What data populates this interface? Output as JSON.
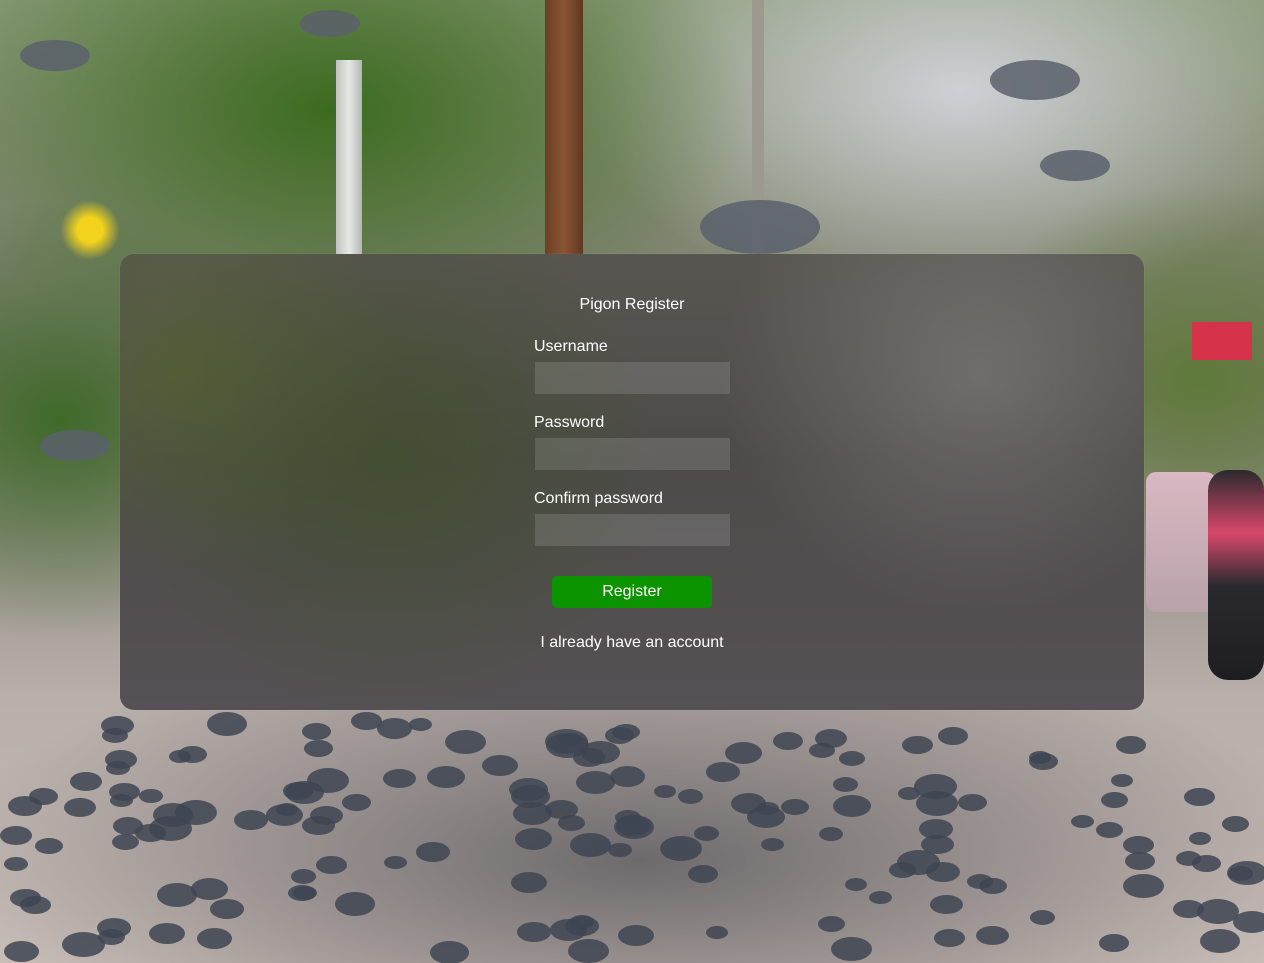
{
  "form": {
    "title": "Pigon Register",
    "fields": [
      {
        "label": "Username",
        "value": "",
        "placeholder": ""
      },
      {
        "label": "Password",
        "value": "",
        "placeholder": ""
      },
      {
        "label": "Confirm password",
        "value": "",
        "placeholder": ""
      }
    ],
    "submit_label": "Register",
    "login_link_text": "I already have an account"
  },
  "colors": {
    "accent": "#0c9400",
    "text": "#ffffff",
    "panel": "#4f4d4c"
  },
  "background": {
    "description_icon": "pigeons-street-photo"
  }
}
